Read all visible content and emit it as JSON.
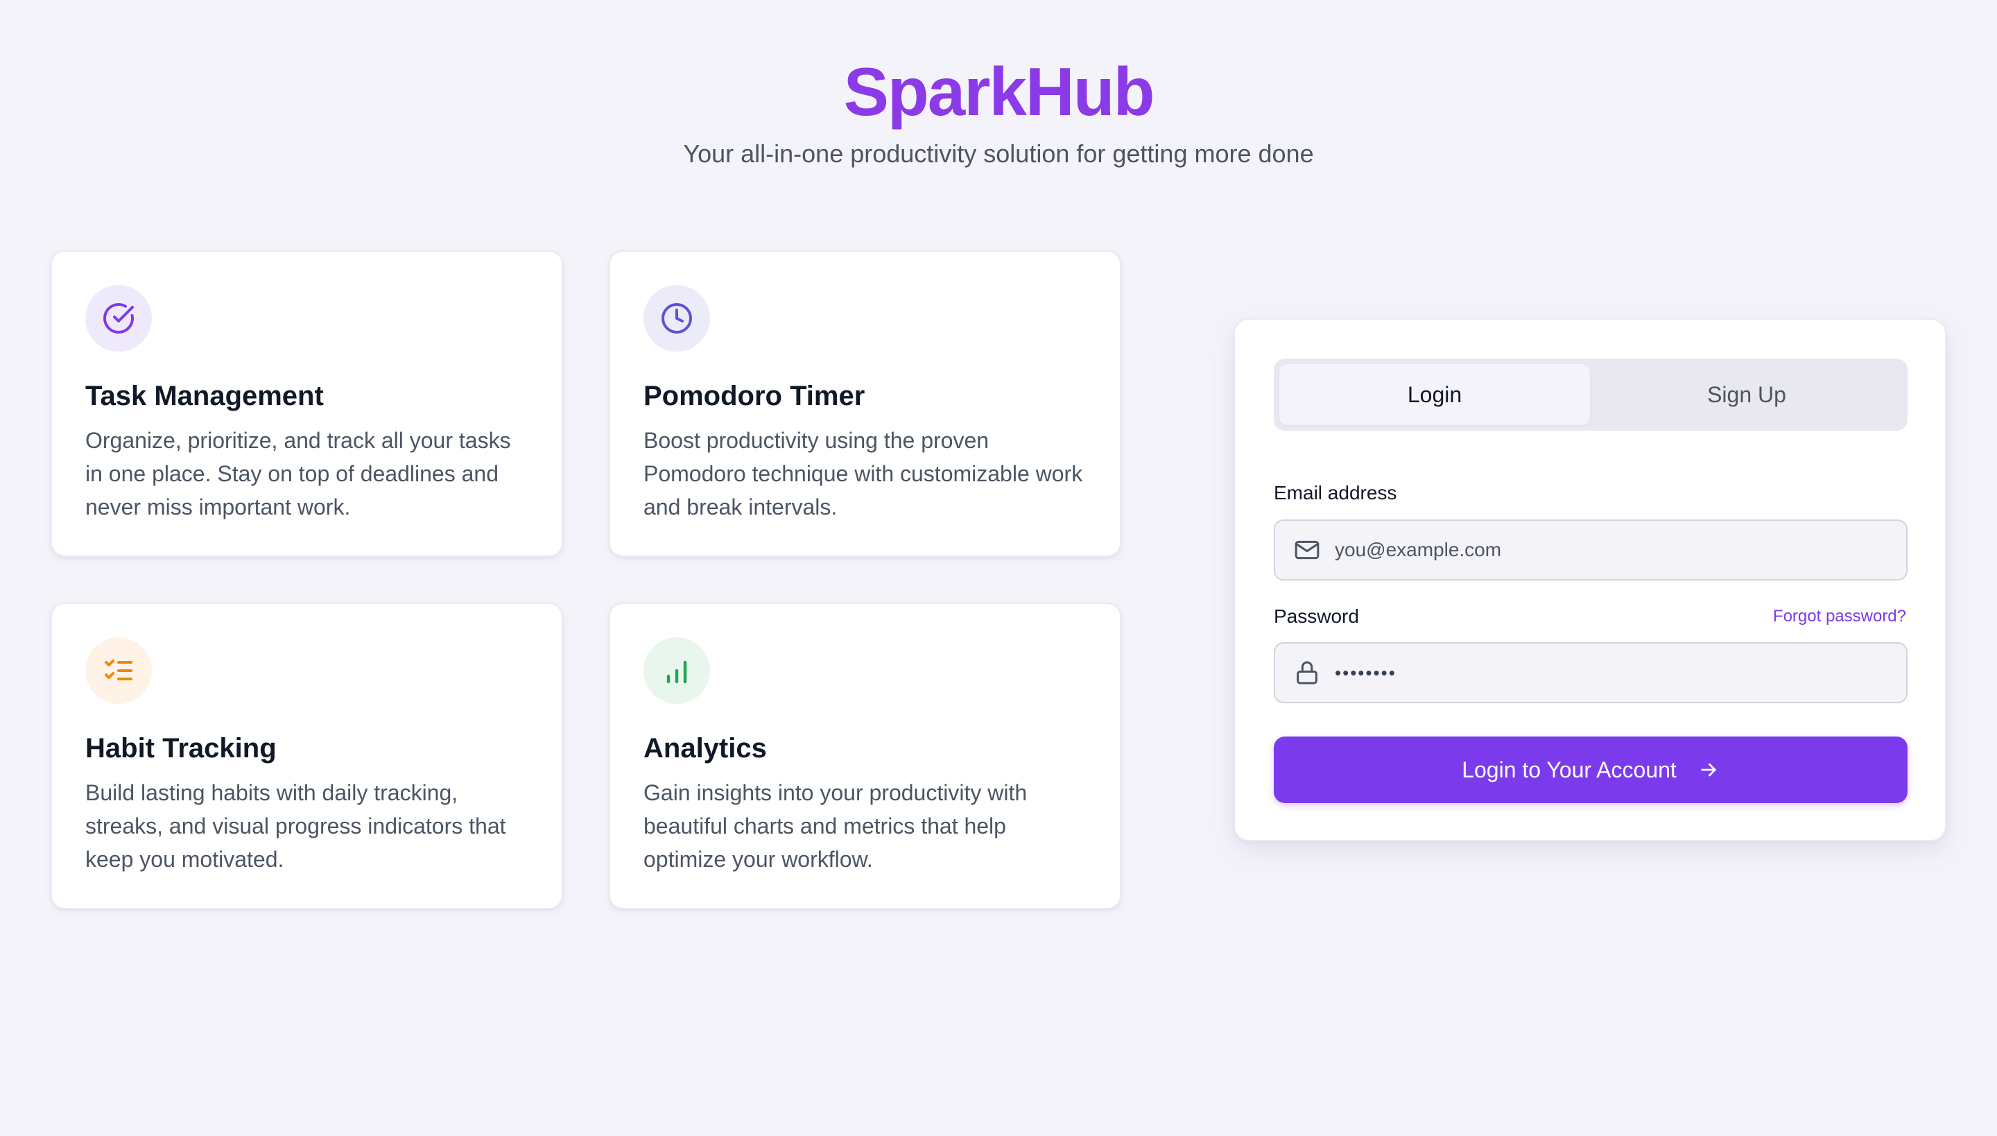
{
  "header": {
    "title": "SparkHub",
    "subtitle": "Your all-in-one productivity solution for getting more done"
  },
  "features": [
    {
      "icon": "check-circle-icon",
      "title": "Task Management",
      "description": "Organize, prioritize, and track all your tasks in one place. Stay on top of deadlines and never miss important work."
    },
    {
      "icon": "clock-icon",
      "title": "Pomodoro Timer",
      "description": "Boost productivity using the proven Pomodoro technique with customizable work and break intervals."
    },
    {
      "icon": "checklist-icon",
      "title": "Habit Tracking",
      "description": "Build lasting habits with daily tracking, streaks, and visual progress indicators that keep you motivated."
    },
    {
      "icon": "bar-chart-icon",
      "title": "Analytics",
      "description": "Gain insights into your productivity with beautiful charts and metrics that help optimize your workflow."
    }
  ],
  "auth": {
    "tabs": {
      "login": "Login",
      "signup": "Sign Up",
      "active": "login"
    },
    "email": {
      "label": "Email address",
      "placeholder": "you@example.com",
      "icon": "mail-icon"
    },
    "password": {
      "label": "Password",
      "value": "••••••••",
      "icon": "lock-icon",
      "forgot_label": "Forgot password?"
    },
    "submit": {
      "label": "Login to Your Account",
      "icon": "arrow-right-icon"
    }
  },
  "colors": {
    "brand": "#8b3ae8",
    "accent": "#7c3aed",
    "background": "#f5f3fa",
    "task_icon": "#7c3aed",
    "task_icon_bg": "#efeafb",
    "timer_icon": "#5b52d6",
    "timer_icon_bg": "#ecebfa",
    "habit_icon": "#ea8a0c",
    "habit_icon_bg": "#fef3e6",
    "analytics_icon": "#22a355",
    "analytics_icon_bg": "#e8f6ed"
  }
}
